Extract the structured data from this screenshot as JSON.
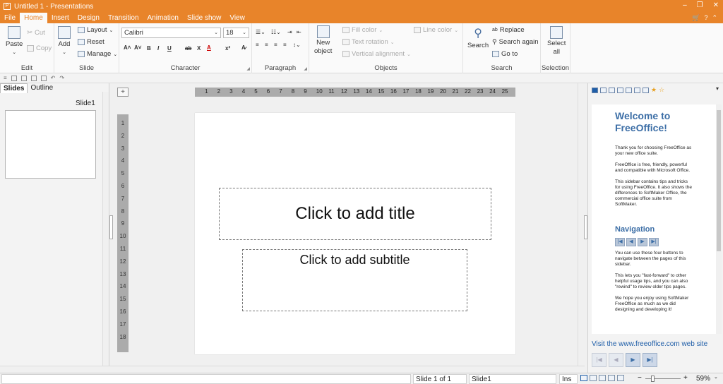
{
  "window": {
    "title": "Untitled 1 - Presentations"
  },
  "menu": [
    "File",
    "Home",
    "Insert",
    "Design",
    "Transition",
    "Animation",
    "Slide show",
    "View"
  ],
  "menu_active": "Home",
  "ribbon": {
    "edit": {
      "label": "Edit",
      "paste": "Paste",
      "cut": "Cut",
      "copy": "Copy"
    },
    "slide": {
      "label": "Slide",
      "add": "Add",
      "layout": "Layout",
      "reset": "Reset",
      "manage": "Manage"
    },
    "character": {
      "label": "Character",
      "font": "Calibri",
      "size": "18"
    },
    "paragraph": {
      "label": "Paragraph"
    },
    "objects": {
      "label": "Objects",
      "new_object": "New",
      "new_object2": "object",
      "fill_color": "Fill color",
      "text_rotation": "Text rotation",
      "vertical_alignment": "Vertical alignment",
      "line_color": "Line color"
    },
    "search": {
      "label": "Search",
      "search": "Search",
      "replace": "Replace",
      "search_again": "Search again",
      "go_to": "Go to"
    },
    "selection": {
      "label": "Selection",
      "select": "Select",
      "all": "all"
    }
  },
  "left_panel": {
    "tab_slides": "Slides",
    "tab_outline": "Outline",
    "thumb_label": "Slide1"
  },
  "hruler_ticks": [
    "1",
    "2",
    "3",
    "4",
    "5",
    "6",
    "7",
    "8",
    "9",
    "10",
    "11",
    "12",
    "13",
    "14",
    "15",
    "16",
    "17",
    "18",
    "19",
    "20",
    "21",
    "22",
    "23",
    "24",
    "25"
  ],
  "vruler_ticks": [
    "1",
    "2",
    "3",
    "4",
    "5",
    "6",
    "7",
    "8",
    "9",
    "10",
    "11",
    "12",
    "13",
    "14",
    "15",
    "16",
    "17",
    "18"
  ],
  "slide": {
    "title_placeholder": "Click to add title",
    "subtitle_placeholder": "Click to add subtitle"
  },
  "sidebar": {
    "welcome_title_1": "Welcome to",
    "welcome_title_2": "FreeOffice!",
    "p1": "Thank you for choosing FreeOffice as your new office suite.",
    "p2": "FreeOffice is free, friendly, powerful and compatible with Microsoft Office.",
    "p3": "This sidebar contains tips and tricks for using FreeOffice. It also shows the differences to SoftMaker Office, the commercial office suite from SoftMaker.",
    "navigation_title": "Navigation",
    "p4": "You can use these four buttons to navigate between the pages of this sidebar.",
    "p5": "This lets you \"fast-forward\" to other helpful usage tips, and you can also \"rewind\" to review older tips pages.",
    "p6": "We hope you enjoy using SoftMaker FreeOffice as much as we did designing and developing it!",
    "link": "Visit the www.freeoffice.com web site"
  },
  "status": {
    "slide_of": "Slide 1 of 1",
    "slide_name": "Slide1",
    "mode": "Ins",
    "zoom": "59%"
  }
}
